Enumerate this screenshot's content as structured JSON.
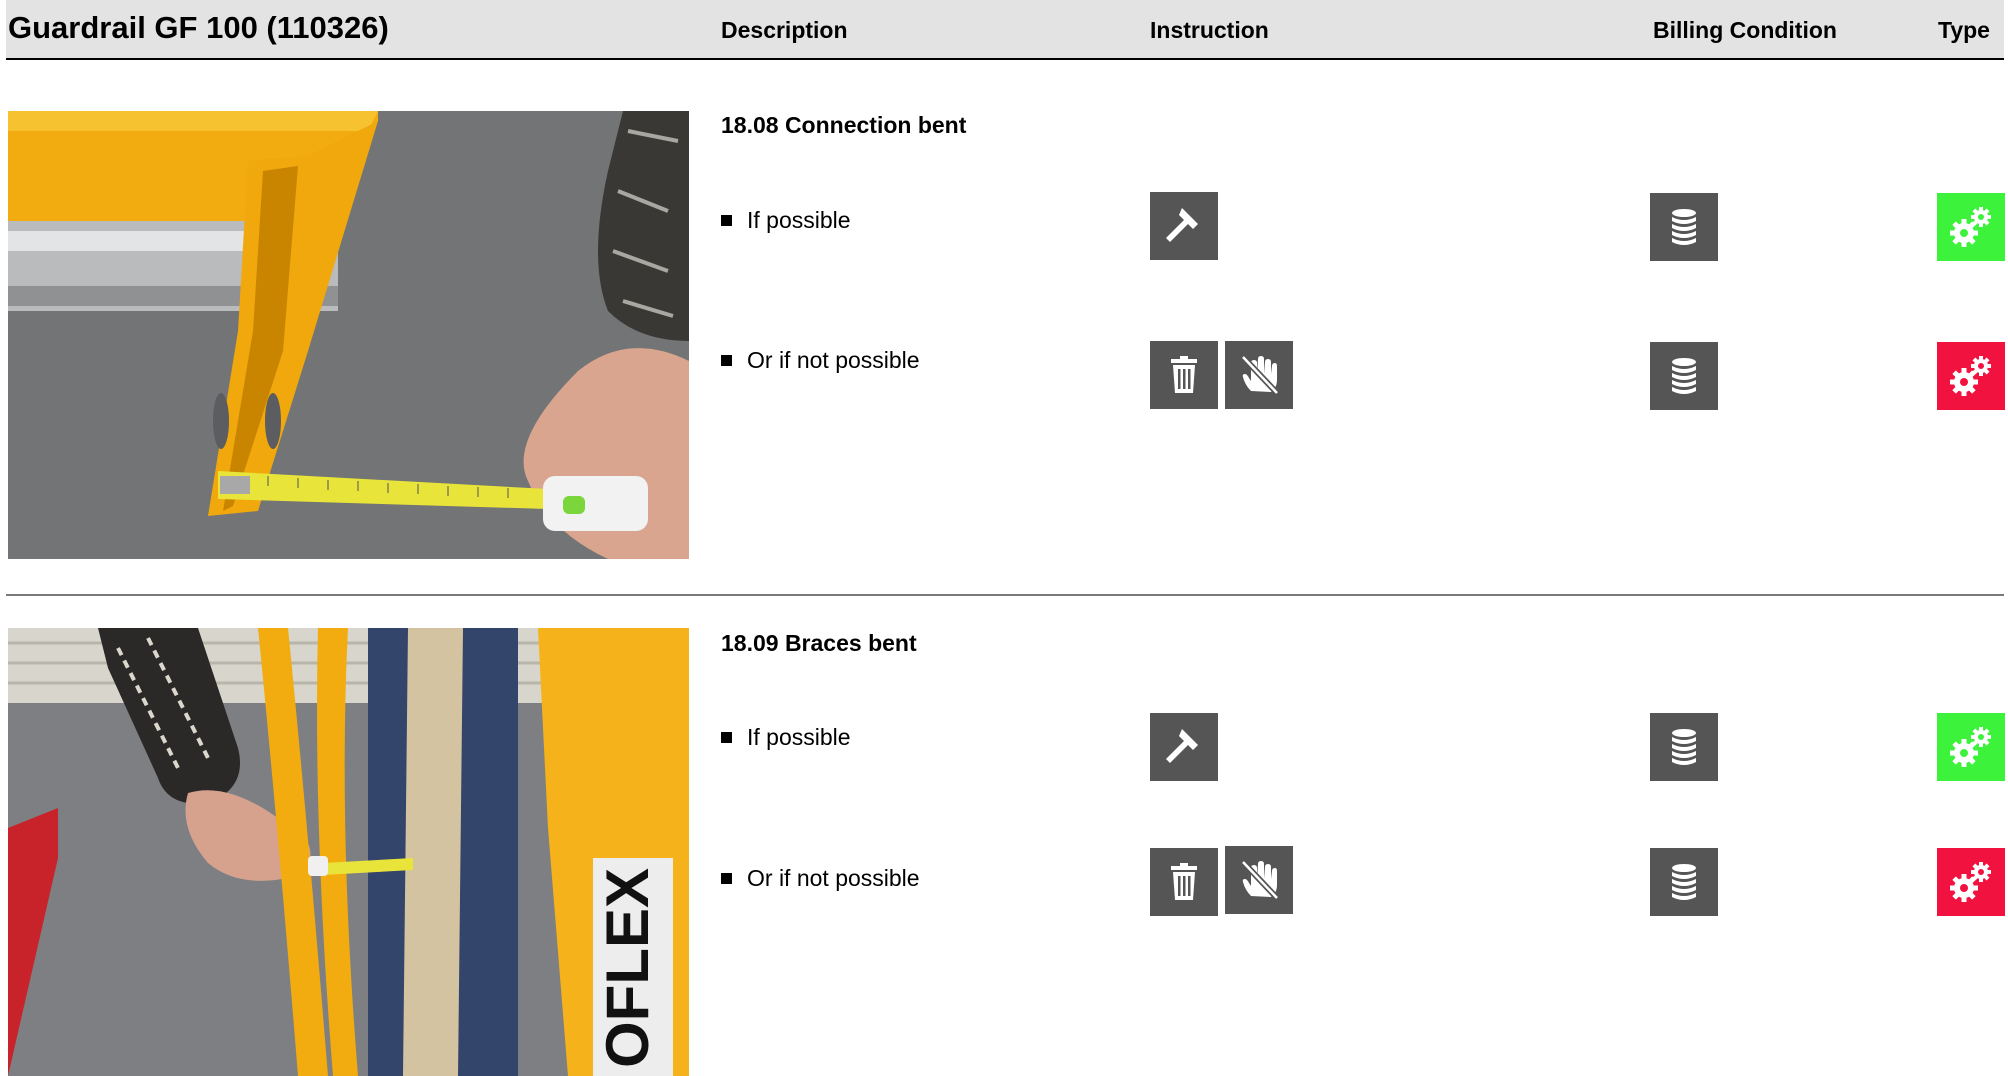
{
  "header": {
    "title": "Guardrail GF 100 (110326)",
    "columns": {
      "description": "Description",
      "instruction": "Instruction",
      "billing": "Billing Condition",
      "type": "Type"
    }
  },
  "sections": [
    {
      "heading": "18.08 Connection bent",
      "photo": "yellow-steel-connection-measured-with-tape",
      "options": [
        {
          "label": "If possible",
          "instruction_icons": [
            "hammer-icon"
          ],
          "billing_icon": "coin-stack-icon",
          "type_icon": "gears-icon",
          "type_color": "#3df23b"
        },
        {
          "label": "Or if not possible",
          "instruction_icons": [
            "trash-icon",
            "no-hand-icon"
          ],
          "billing_icon": "coin-stack-icon",
          "type_icon": "gears-icon",
          "type_color": "#f2123f"
        }
      ]
    },
    {
      "heading": "18.09 Braces bent",
      "photo": "yellow-braces-measured-with-tape",
      "photo_text": "OFLEX",
      "options": [
        {
          "label": "If possible",
          "instruction_icons": [
            "hammer-icon"
          ],
          "billing_icon": "coin-stack-icon",
          "type_icon": "gears-icon",
          "type_color": "#3df23b"
        },
        {
          "label": "Or if not possible",
          "instruction_icons": [
            "trash-icon",
            "no-hand-icon"
          ],
          "billing_icon": "coin-stack-icon",
          "type_icon": "gears-icon",
          "type_color": "#f2123f"
        }
      ]
    }
  ],
  "colors": {
    "icon_bg": "#555555",
    "header_bg": "#e3e3e3",
    "ok": "#3df23b",
    "fail": "#f2123f"
  }
}
